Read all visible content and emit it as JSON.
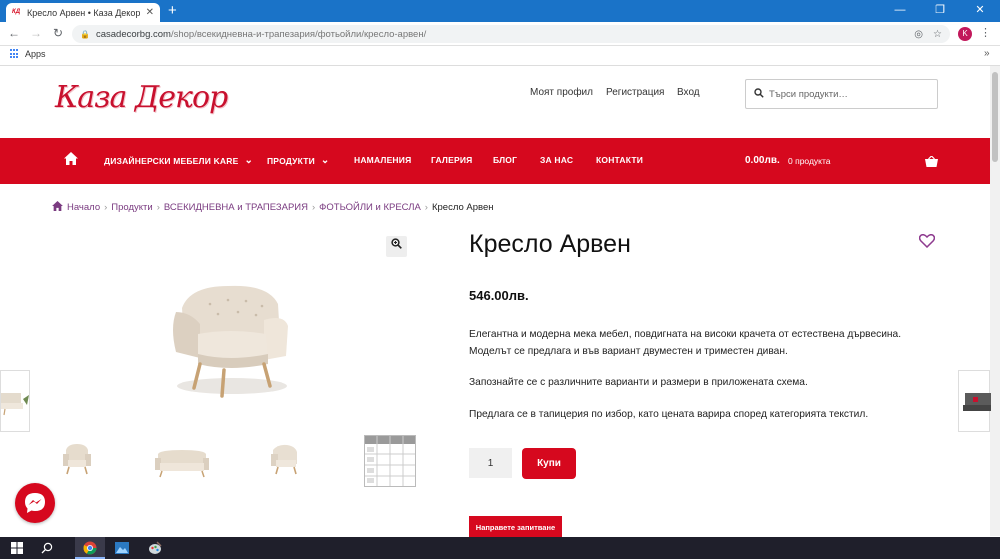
{
  "browser": {
    "tab_title": "Кресло Арвен • Каза Декор",
    "favicon_text": "КД",
    "new_tab": "+",
    "url_host": "casadecorbg.com",
    "url_path": "/shop/всекидневна-и-трапезария/фотьойли/кресло-арвен/",
    "avatar_letter": "K",
    "bookmarks_apps": "Apps",
    "bookmarks_more": "»"
  },
  "site": {
    "logo": "Каза Декор",
    "top_links": [
      "Моят профил",
      "Регистрация",
      "Вход"
    ],
    "search_placeholder": "Търси продукти…",
    "nav": [
      {
        "label": "ДИЗАЙНЕРСКИ МЕБЕЛИ KARE",
        "has_dropdown": true
      },
      {
        "label": "ПРОДУКТИ",
        "has_dropdown": true
      },
      {
        "label": "НАМАЛЕНИЯ",
        "has_dropdown": false
      },
      {
        "label": "ГАЛЕРИЯ",
        "has_dropdown": false
      },
      {
        "label": "БЛОГ",
        "has_dropdown": false
      },
      {
        "label": "ЗА НАС",
        "has_dropdown": false
      },
      {
        "label": "КОНТАКТИ",
        "has_dropdown": false
      }
    ],
    "cart_total": "0.00лв.",
    "cart_count": "0 продукта"
  },
  "breadcrumb": [
    "Начало",
    "Продукти",
    "ВСЕКИДНЕВНА и ТРАПЕЗАРИЯ",
    "ФОТЬОЙЛИ и КРЕСЛА",
    "Кресло Арвен"
  ],
  "product": {
    "title": "Кресло Арвен",
    "price": "546.00лв.",
    "description": [
      "Елегантна и модерна мека мебел, повдигната на високи крачета от естествена дървесина.",
      "Моделът се предлага и във вариант двуместен и триместен диван.",
      "Запознайте се с различните варианти и размери в приложената схема.",
      "Предлага се в тапицерия по избор, като цената варира според категорията текстил."
    ],
    "quantity": "1",
    "buy_label": "Купи",
    "inquiry_label": "Направете запитване"
  },
  "colors": {
    "brand_red": "#d6081e",
    "breadcrumb_link": "#7a3b80",
    "chrome_blue": "#1a73c8"
  }
}
